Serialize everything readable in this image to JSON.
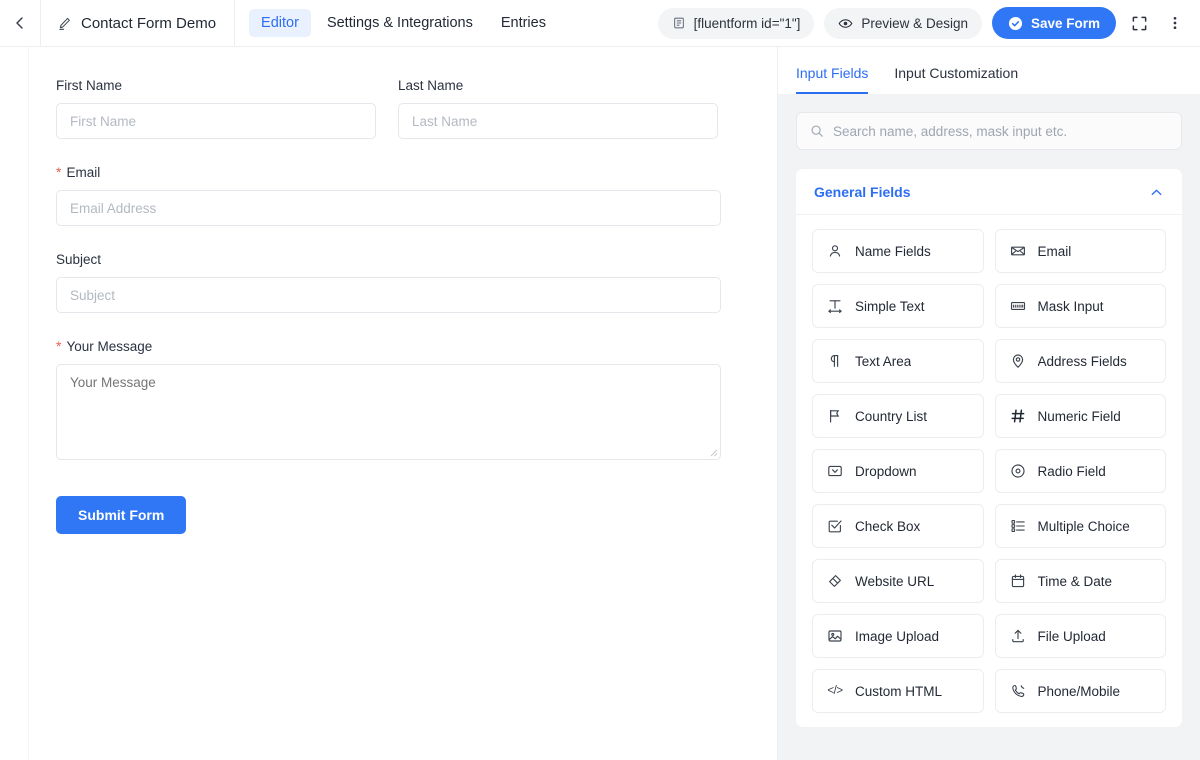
{
  "topbar": {
    "back_icon": "chevron-left-icon",
    "edit_icon": "pencil-icon",
    "form_name": "Contact Form Demo",
    "tabs": [
      {
        "label": "Editor",
        "active": true
      },
      {
        "label": "Settings & Integrations",
        "active": false
      },
      {
        "label": "Entries",
        "active": false
      }
    ],
    "shortcode": "[fluentform id=\"1\"]",
    "shortcode_icon": "copy-icon",
    "preview_label": "Preview & Design",
    "preview_icon": "eye-icon",
    "save_label": "Save Form",
    "save_icon": "check-circle-icon",
    "fullscreen_icon": "fullscreen-icon",
    "more_icon": "kebab-menu-icon",
    "accent": "#2f77f4",
    "tab_active_bg": "#eaf1fe"
  },
  "form": {
    "fields": [
      {
        "label": "First Name",
        "placeholder": "First Name",
        "required": false,
        "width": "half",
        "type": "text"
      },
      {
        "label": "Last Name",
        "placeholder": "Last Name",
        "required": false,
        "width": "half",
        "type": "text"
      },
      {
        "label": "Email",
        "placeholder": "Email Address",
        "required": true,
        "width": "full",
        "type": "text"
      },
      {
        "label": "Subject",
        "placeholder": "Subject",
        "required": false,
        "width": "full",
        "type": "text"
      },
      {
        "label": "Your Message",
        "placeholder": "Your Message",
        "required": true,
        "width": "full",
        "type": "textarea"
      }
    ],
    "required_marker": "*",
    "required_color": "#f05a4f",
    "submit_label": "Submit Form"
  },
  "panel": {
    "tabs": [
      {
        "label": "Input Fields",
        "active": true
      },
      {
        "label": "Input Customization",
        "active": false
      }
    ],
    "search": {
      "placeholder": "Search name, address, mask input etc.",
      "value": "",
      "icon": "search-icon"
    },
    "group": {
      "title": "General Fields",
      "collapse_icon": "chevron-up-icon",
      "items": [
        {
          "label": "Name Fields",
          "icon": "user-icon"
        },
        {
          "label": "Email",
          "icon": "envelope-icon"
        },
        {
          "label": "Simple Text",
          "icon": "text-width-icon"
        },
        {
          "label": "Mask Input",
          "icon": "mask-input-icon"
        },
        {
          "label": "Text Area",
          "icon": "paragraph-icon"
        },
        {
          "label": "Address Fields",
          "icon": "map-pin-icon"
        },
        {
          "label": "Country List",
          "icon": "flag-icon"
        },
        {
          "label": "Numeric Field",
          "icon": "hash-icon"
        },
        {
          "label": "Dropdown",
          "icon": "dropdown-icon"
        },
        {
          "label": "Radio Field",
          "icon": "radio-circle-icon"
        },
        {
          "label": "Check Box",
          "icon": "checkbox-icon"
        },
        {
          "label": "Multiple Choice",
          "icon": "list-choice-icon"
        },
        {
          "label": "Website URL",
          "icon": "link-diamond-icon"
        },
        {
          "label": "Time & Date",
          "icon": "calendar-icon"
        },
        {
          "label": "Image Upload",
          "icon": "image-icon"
        },
        {
          "label": "File Upload",
          "icon": "upload-icon"
        },
        {
          "label": "Custom HTML",
          "icon": "code-icon"
        },
        {
          "label": "Phone/Mobile",
          "icon": "phone-icon"
        }
      ]
    }
  }
}
